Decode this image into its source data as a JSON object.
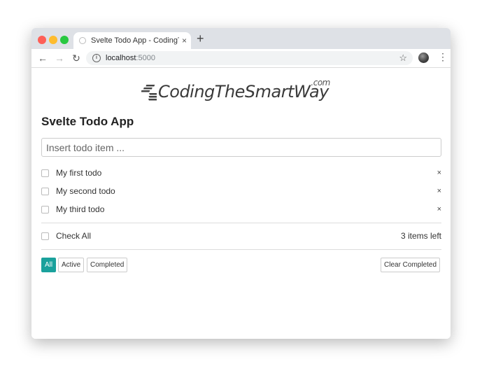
{
  "browser": {
    "tab_title": "Svelte Todo App - CodingTheSmartWay",
    "tab_close": "×",
    "new_tab": "+",
    "url_host": "localhost",
    "url_port": ":5000"
  },
  "logo": {
    "text": "CodingTheSmartWay",
    "suffix": ".com"
  },
  "app": {
    "title": "Svelte Todo App",
    "input_placeholder": "Insert todo item ...",
    "todos": [
      {
        "label": "My first todo",
        "completed": false
      },
      {
        "label": "My second todo",
        "completed": false
      },
      {
        "label": "My third todo",
        "completed": false
      }
    ],
    "remove_symbol": "×",
    "check_all_label": "Check All",
    "items_left": "3 items left",
    "filters": [
      "All",
      "Active",
      "Completed"
    ],
    "active_filter": "All",
    "clear_completed": "Clear Completed"
  },
  "colors": {
    "accent": "#1aa19c"
  }
}
